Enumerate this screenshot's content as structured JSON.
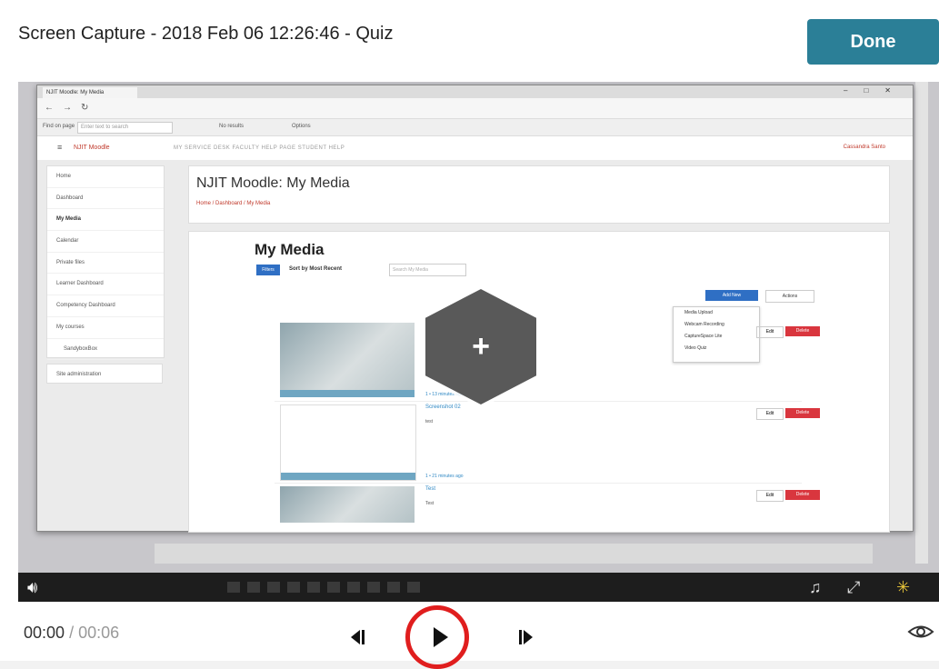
{
  "header": {
    "title": "Screen Capture - 2018 Feb 06 12:26:46 - Quiz",
    "done_label": "Done"
  },
  "browser": {
    "tab_label": "NJIT Moodle: My Media",
    "find_label": "Find on page",
    "find_placeholder": "Enter text to search",
    "find_results": "No results",
    "find_options": "Options",
    "moodle_brand": "NJIT Moodle",
    "moodle_links": "MY SERVICE DESK    FACULTY HELP PAGE    STUDENT HELP",
    "user_name": "Cassandra Santo"
  },
  "moodle": {
    "sidebar": [
      "Home",
      "Dashboard",
      "My Media",
      "Calendar",
      "Private files",
      "Learner Dashboard",
      "Competency Dashboard",
      "My courses",
      "SandyboxBox"
    ],
    "site_admin": "Site administration",
    "page_title": "NJIT Moodle: My Media",
    "breadcrumb": "Home / Dashboard / My Media",
    "my_media_title": "My Media",
    "filter_label": "Filters",
    "sort_label": "Sort by Most Recent",
    "search_placeholder": "Search My Media",
    "add_new_label": "Add New",
    "actions_label": "Actions",
    "add_new_menu": [
      "Media Upload",
      "Webcam Recording",
      "CaptureSpace Lite",
      "Video Quiz"
    ],
    "entries": [
      {
        "name": "",
        "desc": "",
        "meta": "1 • 13 minutes ago"
      },
      {
        "name": "Screenshot 02",
        "desc": "test",
        "meta": "1 • 21 minutes ago"
      },
      {
        "name": "Test",
        "desc": "Test",
        "meta": ""
      }
    ],
    "edit_label": "Edit",
    "delete_label": "Delete"
  },
  "overlay": {
    "plus_symbol": "+"
  },
  "player": {
    "current_time": "00:00",
    "separator": "/",
    "duration": "00:06"
  },
  "colors": {
    "done_bg": "#2b7f97",
    "highlight_ring": "#e01e1e",
    "hex_fill": "#595959"
  },
  "icons": {
    "volume": "volume-icon",
    "prev": "step-back-icon",
    "play": "play-icon",
    "next": "step-forward-icon",
    "eye": "eye-icon",
    "fullscreen": "fullscreen-icon",
    "music": "music-note-icon"
  }
}
